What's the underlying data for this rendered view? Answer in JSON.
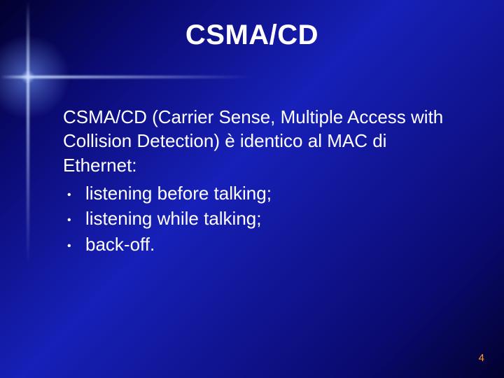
{
  "title": "CSMA/CD",
  "intro": "CSMA/CD (Carrier Sense, Multiple Access with Collision Detection) è identico al MAC di Ethernet:",
  "bullets": [
    "listening before talking;",
    "listening while talking;",
    "back-off."
  ],
  "page_number": "4"
}
